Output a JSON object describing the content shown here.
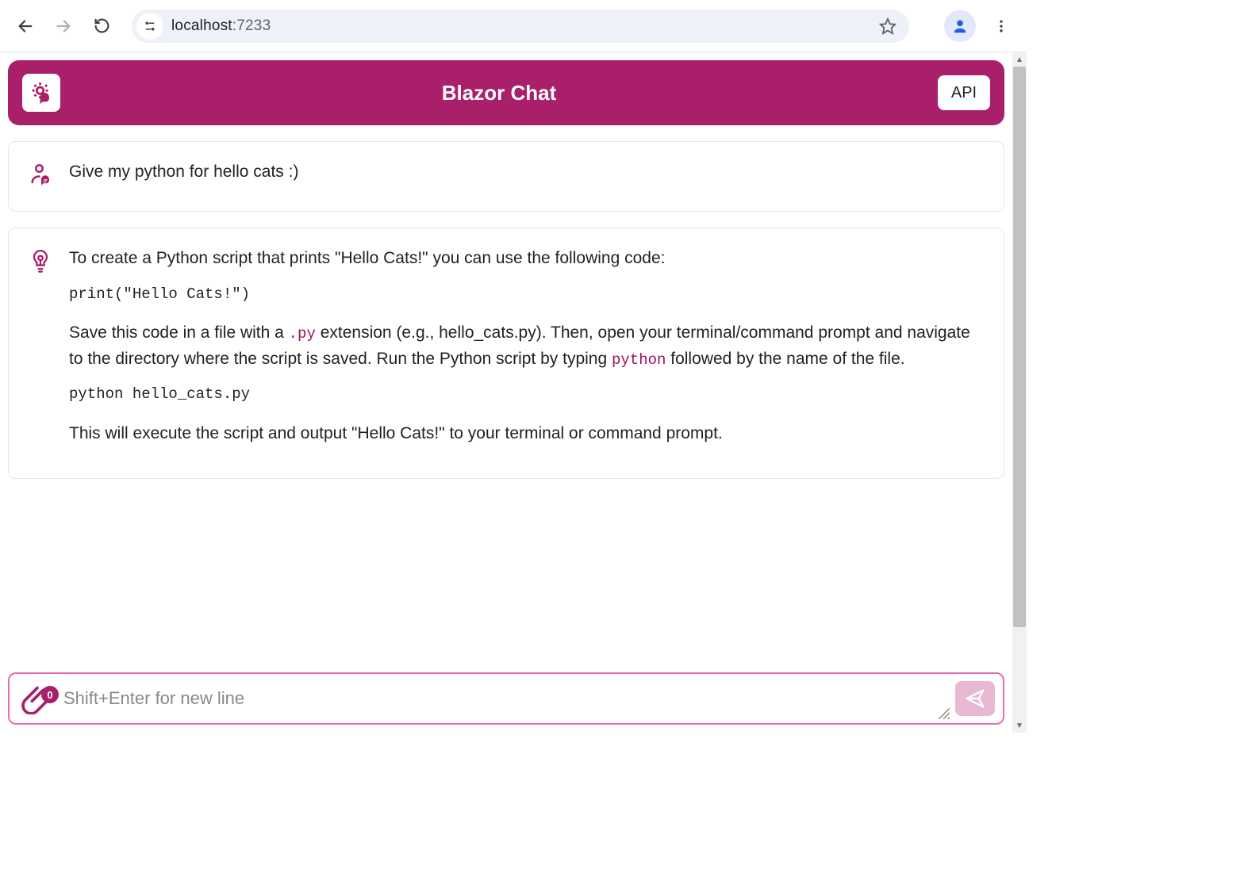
{
  "browser": {
    "url_host": "localhost",
    "url_port": ":7233"
  },
  "header": {
    "title": "Blazor Chat",
    "api_button": "API"
  },
  "messages": {
    "user": {
      "text": "Give my python for hello cats :)"
    },
    "assistant": {
      "p1": "To create a Python script that prints \"Hello Cats!\" you can use the following code:",
      "code1": "print(\"Hello Cats!\")",
      "p2_a": "Save this code in a file with a ",
      "p2_inline1": ".py",
      "p2_b": " extension (e.g., hello_cats.py). Then, open your terminal/command prompt and navigate to the directory where the script is saved. Run the Python script by typing ",
      "p2_inline2": "python",
      "p2_c": " followed by the name of the file.",
      "code2": "python hello_cats.py",
      "p3": "This will execute the script and output \"Hello Cats!\" to your terminal or command prompt."
    }
  },
  "input": {
    "placeholder": "Shift+Enter for new line",
    "attachment_count": "0"
  },
  "colors": {
    "brand": "#aa1f69",
    "input_border": "#e86db0",
    "send_bg": "#e9b9d3"
  }
}
